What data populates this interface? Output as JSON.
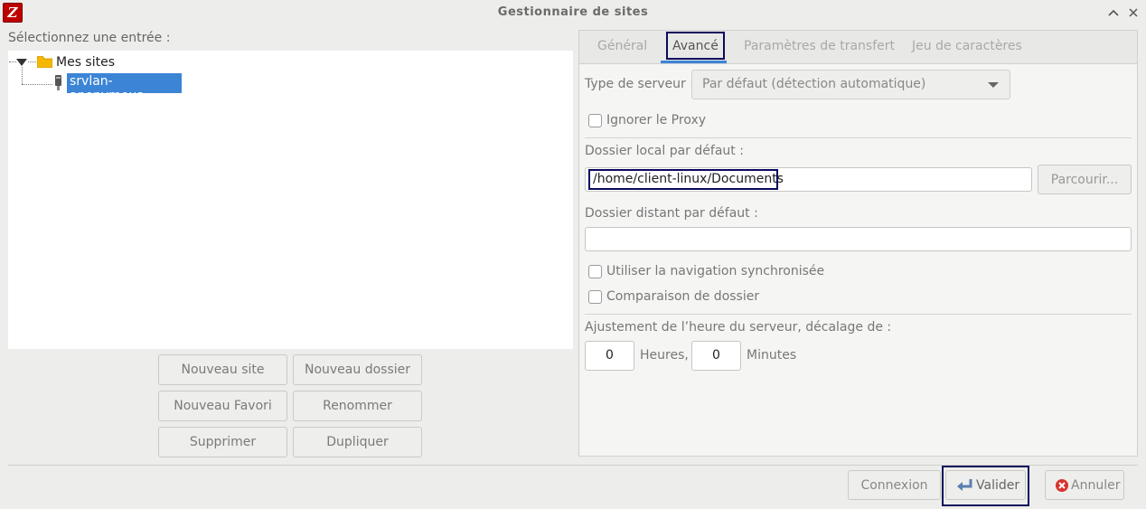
{
  "window": {
    "title": "Gestionnaire de sites",
    "app_icon": "filezilla-icon",
    "app_icon_text": "Z",
    "controls": {
      "collapse": "⌃",
      "close": "✕"
    }
  },
  "left": {
    "select_label": "Sélectionnez une entrée :",
    "tree": {
      "folder": "Mes sites",
      "site": "srvlan-anonymous"
    },
    "buttons": {
      "new_site": "Nouveau site",
      "new_folder": "Nouveau dossier",
      "new_bookmark": "Nouveau Favori",
      "rename": "Renommer",
      "delete": "Supprimer",
      "duplicate": "Dupliquer"
    }
  },
  "tabs": [
    {
      "label": "Général",
      "active": false
    },
    {
      "label": "Avancé",
      "active": true
    },
    {
      "label": "Paramètres de transfert",
      "active": false
    },
    {
      "label": "Jeu de caractères",
      "active": false
    }
  ],
  "advanced": {
    "server_type_label": "Type de serveur :",
    "server_type_value": "Par défaut (détection automatique)",
    "bypass_proxy_label": "Ignorer le Proxy",
    "local_dir_label": "Dossier local par défaut :",
    "local_dir_value": "/home/client-linux/Documents",
    "browse_label": "Parcourir...",
    "remote_dir_label": "Dossier distant par défaut :",
    "remote_dir_value": "",
    "sync_browsing_label": "Utiliser la navigation synchronisée",
    "dir_compare_label": "Comparaison de dossier",
    "time_adjust_label": "Ajustement de l’heure du serveur, décalage de :",
    "hours_value": "0",
    "hours_label": "Heures,",
    "minutes_value": "0",
    "minutes_label": "Minutes"
  },
  "footer": {
    "connect": "Connexion",
    "ok": "Valider",
    "cancel": "Annuler"
  },
  "colors": {
    "selection": "#3c84d6",
    "highlight_box": "#0a0a5e",
    "cancel_icon": "#d9322c",
    "folder": "#f5b800"
  }
}
